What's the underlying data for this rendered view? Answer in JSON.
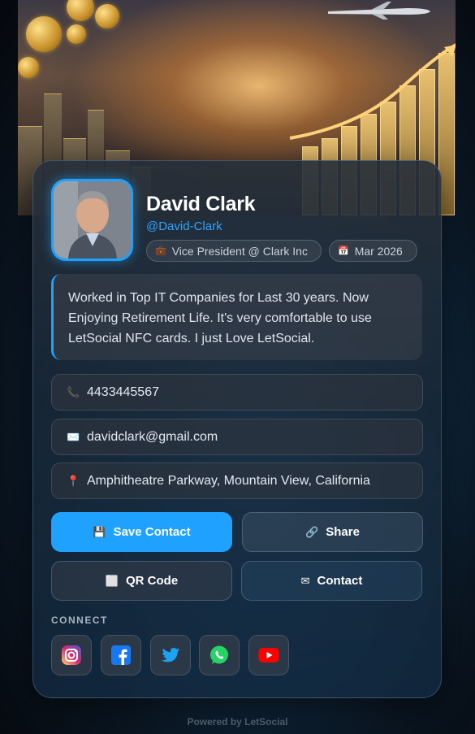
{
  "profile": {
    "name": "David Clark",
    "handle": "@David-Clark",
    "role": "Vice President @ Clark Inc",
    "date": "Mar 2026",
    "bio": "Worked in Top IT Companies for Last 30 years. Now Enjoying Retirement Life. It's very comfortable to use LetSocial NFC cards. I just Love LetSocial."
  },
  "contact": {
    "phone": "4433445567",
    "email": "davidclark@gmail.com",
    "address": "Amphitheatre Parkway, Mountain View, California"
  },
  "actions": {
    "save": "Save Contact",
    "share": "Share",
    "qr": "QR Code",
    "contact": "Contact"
  },
  "connect": {
    "label": "CONNECT",
    "networks": [
      "instagram-icon",
      "facebook-icon",
      "twitter-icon",
      "whatsapp-icon",
      "youtube-icon"
    ]
  },
  "footer": "Powered by LetSocial",
  "colors": {
    "accent": "#1fa2ff",
    "instagram": "#e1306c",
    "facebook": "#1877f2",
    "twitter": "#1da1f2",
    "whatsapp": "#25d366",
    "youtube": "#ff0000"
  }
}
